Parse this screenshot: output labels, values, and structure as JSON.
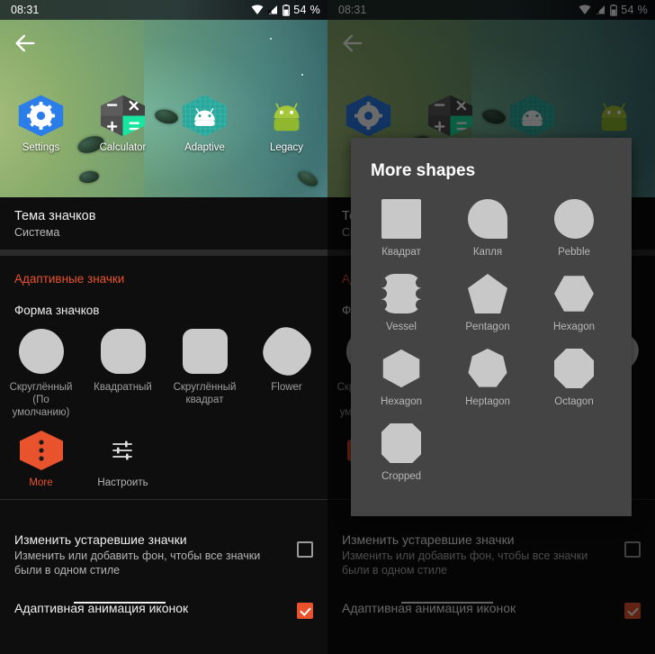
{
  "statusbar": {
    "time": "08:31",
    "battery_text": "54 %",
    "icons": [
      "wifi-icon",
      "cell-signal-off-icon",
      "battery-icon"
    ]
  },
  "nav": {
    "back_label": "back-arrow"
  },
  "home_apps": [
    {
      "label": "Settings",
      "icon": "settings-gear-icon"
    },
    {
      "label": "Calculator",
      "icon": "calculator-icon"
    },
    {
      "label": "Adaptive",
      "icon": "android-adaptive-icon"
    },
    {
      "label": "Legacy",
      "icon": "android-legacy-icon"
    }
  ],
  "settings": {
    "theme_row": {
      "title": "Тема значков",
      "value": "Система"
    },
    "section_adaptive": "Адаптивные значки",
    "shape_section": "Форма значков",
    "shapes": [
      {
        "label": "Скруглённый\n(По умолчанию)",
        "shape": "circle"
      },
      {
        "label": "Квадратный",
        "shape": "squircle"
      },
      {
        "label": "Скруглённый квадрат",
        "shape": "rounded-square"
      },
      {
        "label": "Flower",
        "shape": "flower"
      }
    ],
    "actions": [
      {
        "label": "More",
        "icon": "more-hexagon-icon"
      },
      {
        "label": "Настроить",
        "icon": "tune-sliders-icon"
      }
    ],
    "prefs": [
      {
        "title": "Изменить устаревшие значки",
        "summary": "Изменить или добавить фон, чтобы все значки были в одном стиле",
        "checked": false
      },
      {
        "title": "Адаптивная анимация иконок",
        "summary": "",
        "checked": true
      }
    ]
  },
  "dialog": {
    "title": "More shapes",
    "items": [
      {
        "label": "Квадрат",
        "shape": "square"
      },
      {
        "label": "Капля",
        "shape": "teardrop"
      },
      {
        "label": "Pebble",
        "shape": "pebble"
      },
      {
        "label": "Vessel",
        "shape": "vessel"
      },
      {
        "label": "Pentagon",
        "shape": "pentagon"
      },
      {
        "label": "Hexagon",
        "shape": "hexagon"
      },
      {
        "label": "Hexagon",
        "shape": "hexagon2"
      },
      {
        "label": "Heptagon",
        "shape": "heptagon"
      },
      {
        "label": "Octagon",
        "shape": "octagon"
      },
      {
        "label": "Cropped",
        "shape": "cropped"
      }
    ]
  },
  "colors": {
    "accent": "#e8532e",
    "dialog_bg": "#444444",
    "page_bg": "#0e0e0e",
    "shape_fill": "#c8c8c8"
  }
}
